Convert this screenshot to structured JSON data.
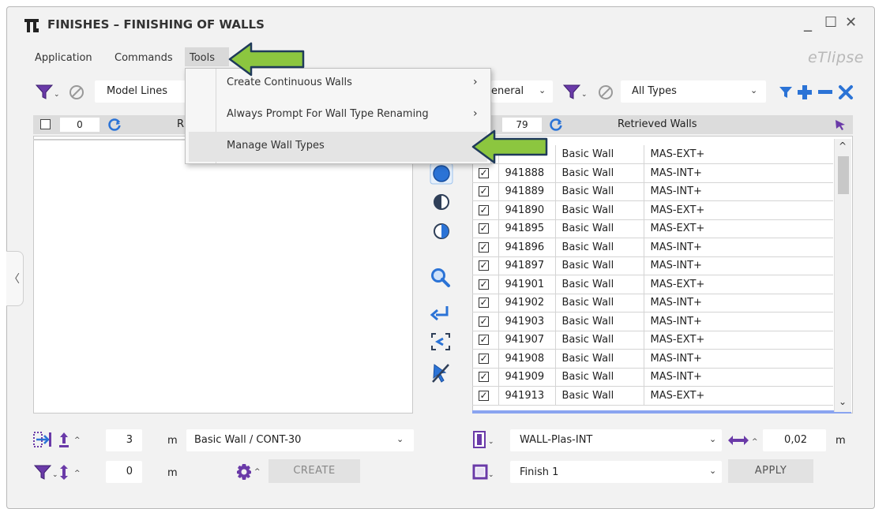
{
  "window": {
    "title": "FINISHES – FINISHING OF WALLS",
    "minimize": "_",
    "maximize": "☐",
    "close": "✕",
    "brand": "eTlipse"
  },
  "menubar": {
    "application": "Application",
    "commands": "Commands",
    "tools": "Tools"
  },
  "tools_menu": {
    "items": [
      {
        "label": "Create Continuous Walls",
        "has_submenu": true,
        "arrow": "›"
      },
      {
        "label": "Always Prompt For Wall Type Renaming",
        "has_submenu": true,
        "arrow": "›"
      },
      {
        "label": "Manage Wall Types",
        "has_submenu": false,
        "highlighted": true
      }
    ]
  },
  "left_panel": {
    "filter_select": "Model Lines",
    "count": "0",
    "header_partial": "R"
  },
  "right_panel": {
    "category_select": "eneral",
    "type_filter": "All Types",
    "count": "79",
    "header": "Retrieved Walls",
    "rows": [
      {
        "id": "",
        "family": "Basic Wall",
        "type": "MAS-EXT+",
        "checked": true
      },
      {
        "id": "941888",
        "family": "Basic Wall",
        "type": "MAS-INT+",
        "checked": true
      },
      {
        "id": "941889",
        "family": "Basic Wall",
        "type": "MAS-INT+",
        "checked": true
      },
      {
        "id": "941890",
        "family": "Basic Wall",
        "type": "MAS-EXT+",
        "checked": true
      },
      {
        "id": "941895",
        "family": "Basic Wall",
        "type": "MAS-EXT+",
        "checked": true
      },
      {
        "id": "941896",
        "family": "Basic Wall",
        "type": "MAS-INT+",
        "checked": true
      },
      {
        "id": "941897",
        "family": "Basic Wall",
        "type": "MAS-INT+",
        "checked": true
      },
      {
        "id": "941901",
        "family": "Basic Wall",
        "type": "MAS-EXT+",
        "checked": true
      },
      {
        "id": "941902",
        "family": "Basic Wall",
        "type": "MAS-INT+",
        "checked": true
      },
      {
        "id": "941903",
        "family": "Basic Wall",
        "type": "MAS-INT+",
        "checked": true
      },
      {
        "id": "941907",
        "family": "Basic Wall",
        "type": "MAS-EXT+",
        "checked": true
      },
      {
        "id": "941908",
        "family": "Basic Wall",
        "type": "MAS-INT+",
        "checked": true
      },
      {
        "id": "941909",
        "family": "Basic Wall",
        "type": "MAS-INT+",
        "checked": true
      },
      {
        "id": "941913",
        "family": "Basic Wall",
        "type": "MAS-EXT+",
        "checked": true
      }
    ]
  },
  "bottom_left": {
    "height_value": "3",
    "height_unit": "m",
    "wall_type": "Basic Wall / CONT-30",
    "offset_value": "0",
    "offset_unit": "m",
    "create_label": "CREATE"
  },
  "bottom_right": {
    "finish_wall_type": "WALL-Plas-INT",
    "thickness_value": "0,02",
    "thickness_unit": "m",
    "finish_name": "Finish 1",
    "apply_label": "APPLY"
  },
  "collapse_glyph": "〈",
  "colors": {
    "accent_blue": "#2b73d6",
    "icon_purple": "#6a3aa8",
    "callout_green": "#8cc63f",
    "callout_outline": "#1f3a5a"
  }
}
